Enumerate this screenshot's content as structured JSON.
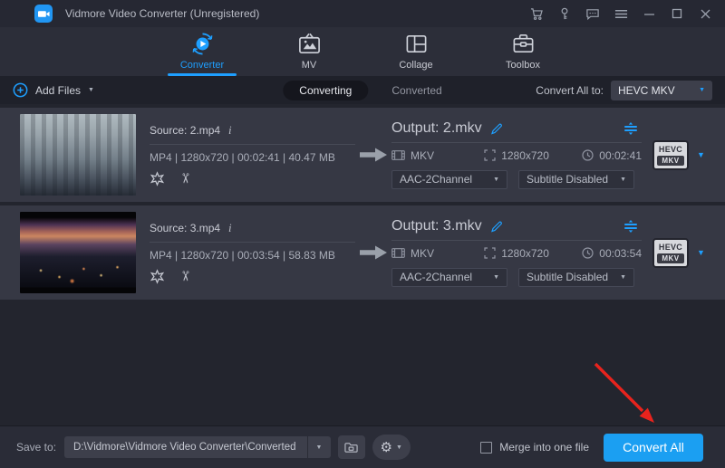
{
  "titlebar": {
    "title": "Vidmore Video Converter (Unregistered)"
  },
  "nav": {
    "tabs": [
      {
        "label": "Converter"
      },
      {
        "label": "MV"
      },
      {
        "label": "Collage"
      },
      {
        "label": "Toolbox"
      }
    ]
  },
  "toolbar": {
    "add_files": "Add Files",
    "converting_tab": "Converting",
    "converted_tab": "Converted",
    "convert_all_to_label": "Convert All to:",
    "convert_all_to_value": "HEVC MKV"
  },
  "files": [
    {
      "source_label": "Source: 2.mp4",
      "source_info": "MP4 | 1280x720 | 00:02:41 | 40.47 MB",
      "output_label": "Output: 2.mkv",
      "format": "MKV",
      "resolution": "1280x720",
      "duration": "00:02:41",
      "audio": "AAC-2Channel",
      "subtitle": "Subtitle Disabled",
      "badge_top": "HEVC",
      "badge_bottom": "MKV"
    },
    {
      "source_label": "Source: 3.mp4",
      "source_info": "MP4 | 1280x720 | 00:03:54 | 58.83 MB",
      "output_label": "Output: 3.mkv",
      "format": "MKV",
      "resolution": "1280x720",
      "duration": "00:03:54",
      "audio": "AAC-2Channel",
      "subtitle": "Subtitle Disabled",
      "badge_top": "HEVC",
      "badge_bottom": "MKV"
    }
  ],
  "footer": {
    "save_to_label": "Save to:",
    "save_path": "D:\\Vidmore\\Vidmore Video Converter\\Converted",
    "merge_label": "Merge into one file",
    "convert_all_label": "Convert All"
  },
  "colors": {
    "accent_blue": "#1e9fff",
    "convert_button": "#1b9ff2",
    "annotation_arrow": "#e8231d"
  }
}
